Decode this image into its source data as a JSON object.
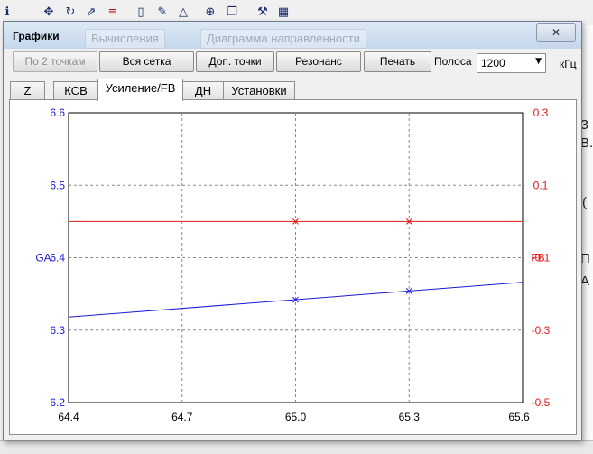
{
  "dialog": {
    "title": "Графики",
    "background_tabs": [
      "Вычисления",
      "Диаграмма направленности"
    ],
    "close_icon": "close-icon"
  },
  "toolbar": {
    "buttons": [
      {
        "label": "По 2 точкам",
        "enabled": false
      },
      {
        "label": "Вся сетка",
        "enabled": true
      },
      {
        "label": "Доп. точки",
        "enabled": true
      },
      {
        "label": "Резонанс",
        "enabled": true
      },
      {
        "label": "Печать",
        "enabled": true
      }
    ],
    "band_label": "Полоса",
    "band_value": "1200",
    "band_unit": "кГц"
  },
  "tabs": [
    {
      "label": "Z",
      "active": false
    },
    {
      "label": "КСВ",
      "active": false
    },
    {
      "label": "Усиление/FB",
      "active": true
    },
    {
      "label": "ДН",
      "active": false
    },
    {
      "label": "Установки",
      "active": false
    }
  ],
  "chart_data": {
    "type": "line",
    "x": [
      64.4,
      65.6
    ],
    "x_ticks": [
      "64.4",
      "64.7",
      "65.0",
      "65.3",
      "65.6"
    ],
    "xlim": [
      64.4,
      65.6
    ],
    "grid": true,
    "y_left": {
      "label": "GA",
      "ticks": [
        "6.6",
        "6.5",
        "6.4",
        "6.3",
        "6.2"
      ],
      "ylim": [
        6.2,
        6.6
      ],
      "color": "#1a1ad6"
    },
    "y_right": {
      "label": "FB",
      "ticks": [
        "0.3",
        "0.1",
        "-0.1",
        "-0.3",
        "-0.5"
      ],
      "ylim": [
        -0.5,
        0.3
      ],
      "color": "#e01a1a"
    },
    "series": [
      {
        "name": "GA",
        "axis": "left",
        "color": "#1a1ad6",
        "points": [
          [
            64.4,
            6.318
          ],
          [
            65.0,
            6.342
          ],
          [
            65.3,
            6.354
          ],
          [
            65.6,
            6.366
          ]
        ],
        "markers": [
          [
            65.0,
            6.342
          ],
          [
            65.3,
            6.354
          ]
        ]
      },
      {
        "name": "FB",
        "axis": "right",
        "color": "#e01a1a",
        "points": [
          [
            64.4,
            0.0
          ],
          [
            65.6,
            0.0
          ]
        ],
        "markers": [
          [
            65.0,
            0.0
          ],
          [
            65.3,
            0.0
          ]
        ]
      }
    ]
  },
  "background": {
    "toolbar_icons": [
      "info-icon",
      "move-icon",
      "rotate-icon",
      "export-icon",
      "list-icon",
      "page-icon",
      "edit-icon",
      "triangle-icon",
      "target-icon",
      "copy-icon",
      "tools-icon",
      "calculator-icon"
    ],
    "right_edge_glyphs": [
      "З",
      "В.",
      "(",
      "П",
      "A"
    ]
  }
}
